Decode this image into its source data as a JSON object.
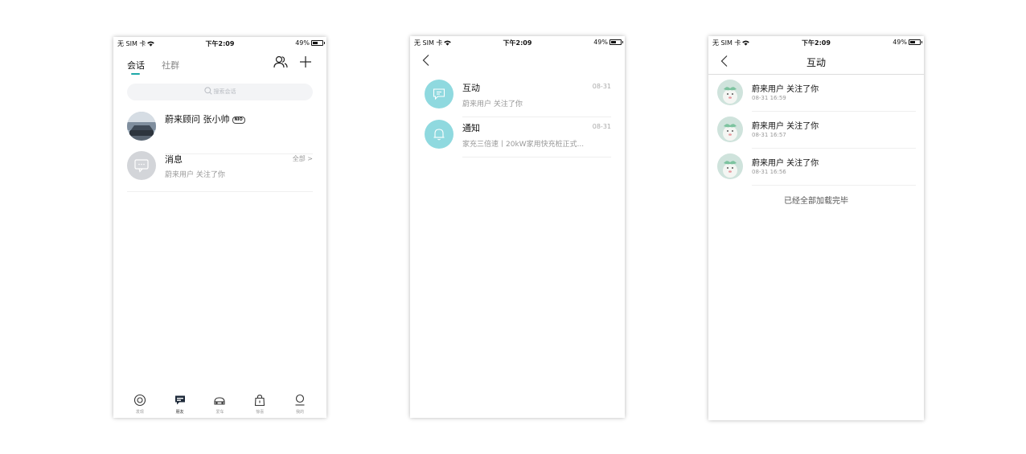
{
  "status": {
    "carrier": "无 SIM 卡",
    "time": "下午2:09",
    "battery": "49%"
  },
  "messages_screen": {
    "tabs": [
      {
        "label": "会话",
        "active": true
      },
      {
        "label": "社群",
        "active": false
      }
    ],
    "search_placeholder": "搜索会话",
    "conversations": [
      {
        "name": "蔚来顾问 张小帅",
        "badge": "NIO",
        "subtitle": "",
        "right": ""
      },
      {
        "name": "消息",
        "badge": "",
        "subtitle": "蔚来用户 关注了你",
        "right": "全部 >"
      }
    ],
    "bottom_nav": [
      {
        "label": "发现",
        "icon": "compass-icon",
        "active": false
      },
      {
        "label": "朋友",
        "icon": "chat-icon",
        "active": true
      },
      {
        "label": "爱车",
        "icon": "car-icon",
        "active": false
      },
      {
        "label": "惊喜",
        "icon": "bag-icon",
        "active": false
      },
      {
        "label": "我的",
        "icon": "person-icon",
        "active": false
      }
    ]
  },
  "categories_screen": {
    "items": [
      {
        "name": "互动",
        "subtitle": "蔚来用户 关注了你",
        "date": "08-31",
        "icon": "comment-icon"
      },
      {
        "name": "通知",
        "subtitle": "家充三倍速丨20kW家用快充桩正式...",
        "date": "08-31",
        "icon": "bell-icon"
      }
    ]
  },
  "interactions_screen": {
    "title": "互动",
    "items": [
      {
        "text": "蔚来用户 关注了你",
        "time": "08-31 16:59"
      },
      {
        "text": "蔚来用户 关注了你",
        "time": "08-31 16:57"
      },
      {
        "text": "蔚来用户 关注了你",
        "time": "08-31 16:56"
      }
    ],
    "end_text": "已经全部加载完毕"
  },
  "colors": {
    "accent": "#1ca8a8",
    "category_circle": "#8fd9df",
    "search_bg": "#f3f4f6"
  }
}
